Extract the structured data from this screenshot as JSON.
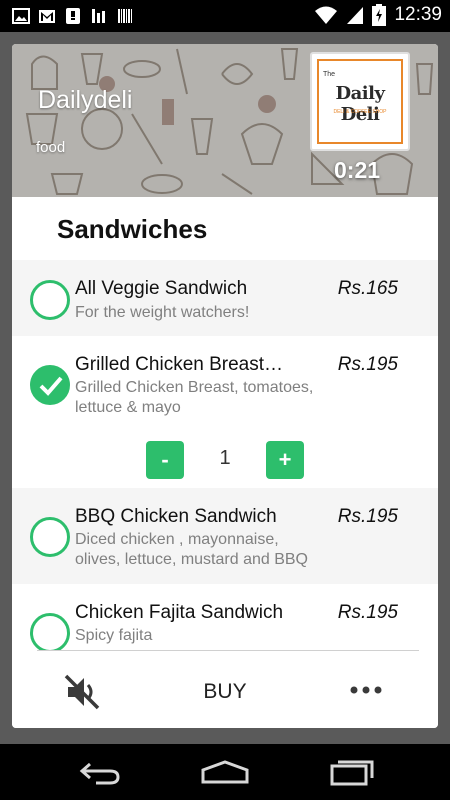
{
  "status_bar": {
    "time": "12:39",
    "left_icons": [
      "image-icon",
      "gmail-icon",
      "notification-icon",
      "signal-bars-icon",
      "barcode-icon"
    ],
    "right_icons": [
      "wifi-icon",
      "cell-signal-icon",
      "battery-charging-icon"
    ]
  },
  "header": {
    "shop_name": "Dailydeli",
    "category": "food",
    "logo": {
      "brand_text": "Daily Deli",
      "prefix": "The",
      "tagline": "DELI & COFFEE SHOP"
    },
    "timer": "0:21"
  },
  "section": {
    "title": "Sandwiches"
  },
  "items": [
    {
      "name": "All Veggie Sandwich",
      "description": "For the weight watchers!",
      "price": "Rs.165",
      "selected": false
    },
    {
      "name": "Grilled Chicken Breast Sandwich",
      "description": "Grilled Chicken Breast, tomatoes, lettuce & mayo",
      "price": "Rs.195",
      "selected": true,
      "quantity": "1"
    },
    {
      "name": "BBQ Chicken Sandwich",
      "description": "Diced chicken , mayonnaise, olives, lettuce, mustard and BBQ sauce",
      "price": "Rs.195",
      "selected": false
    },
    {
      "name": "Chicken Fajita Sandwich",
      "description": "Spicy fajita",
      "price": "Rs.195",
      "selected": false
    }
  ],
  "quantity_controls": {
    "minus_label": "-",
    "plus_label": "+"
  },
  "actions": {
    "mute_icon": "volume-off-icon",
    "buy_label": "BUY",
    "more_icon": "more-horizontal-icon"
  },
  "nav_bar": {
    "icons": [
      "back-icon",
      "home-icon",
      "recents-icon"
    ]
  },
  "colors": {
    "accent": "#2dbe6c",
    "logo_border": "#e8872a"
  }
}
